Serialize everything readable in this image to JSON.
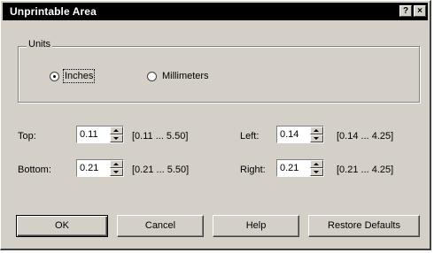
{
  "window": {
    "title": "Unprintable Area",
    "help_glyph": "?",
    "close_glyph": "×"
  },
  "units": {
    "label": "Units",
    "options": [
      {
        "label": "Inches",
        "selected": true
      },
      {
        "label": "Millimeters",
        "selected": false
      }
    ]
  },
  "fields": {
    "top": {
      "label": "Top:",
      "value": "0.11",
      "range": "[0.11 ... 5.50]"
    },
    "bottom": {
      "label": "Bottom:",
      "value": "0.21",
      "range": "[0.21 ... 5.50]"
    },
    "left": {
      "label": "Left:",
      "value": "0.14",
      "range": "[0.14 ... 4.25]"
    },
    "right": {
      "label": "Right:",
      "value": "0.21",
      "range": "[0.21 ... 4.25]"
    }
  },
  "buttons": {
    "ok": "OK",
    "cancel": "Cancel",
    "help": "Help",
    "restore": "Restore Defaults"
  }
}
